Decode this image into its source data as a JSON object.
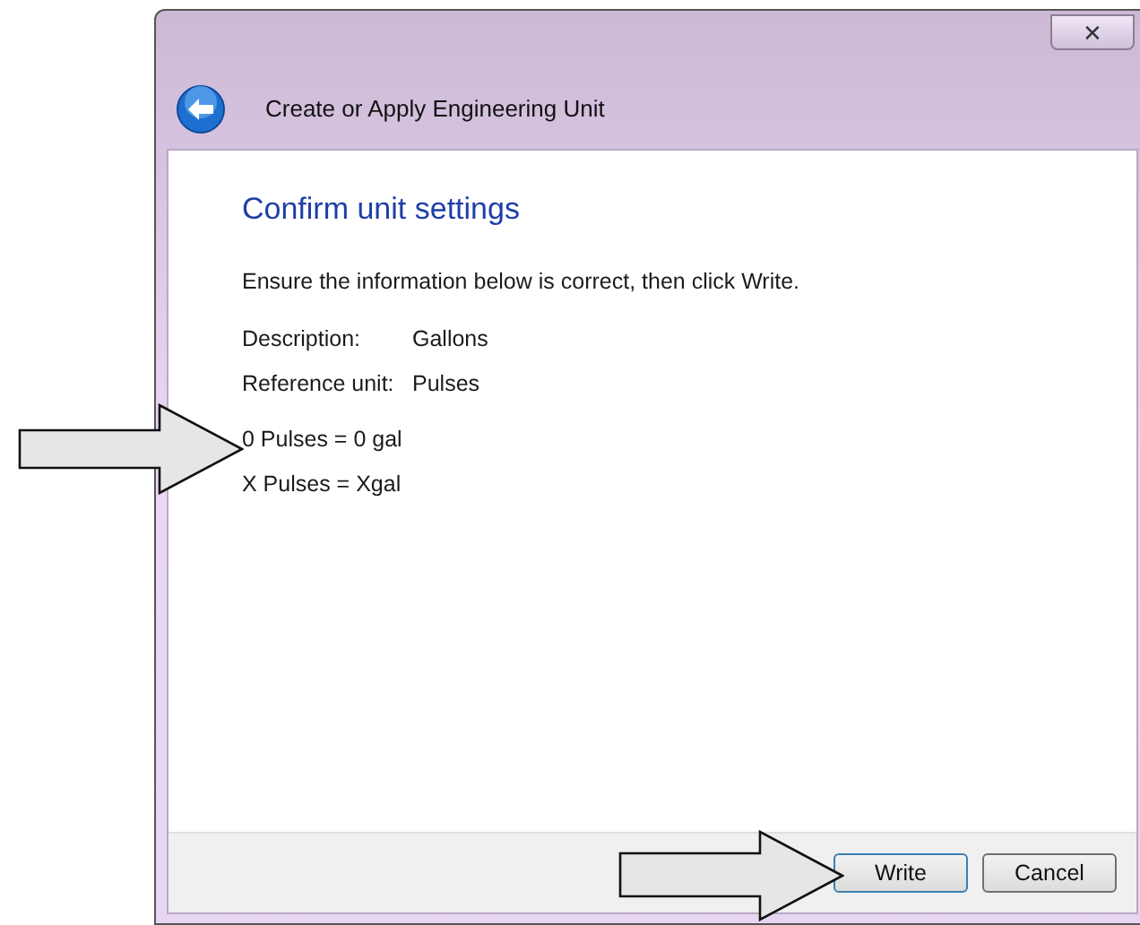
{
  "window": {
    "title": "Create or Apply Engineering Unit",
    "close": "✕"
  },
  "heading": "Confirm unit settings",
  "instruction": "Ensure the information below is correct, then click Write.",
  "fields": [
    {
      "label": "Description:",
      "value": "Gallons"
    },
    {
      "label": "Reference unit:",
      "value": "Pulses"
    }
  ],
  "equations": [
    "0 Pulses = 0 gal",
    "X Pulses = Xgal"
  ],
  "buttons": [
    {
      "label": "Write",
      "default": true
    },
    {
      "label": "Cancel",
      "default": false
    }
  ]
}
